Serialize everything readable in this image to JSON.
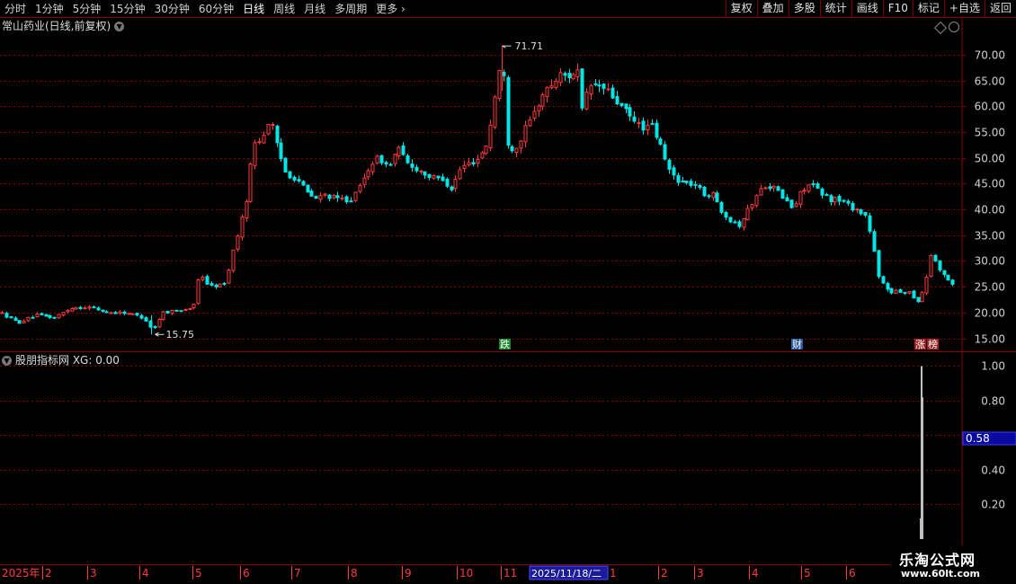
{
  "toolbar": {
    "periods": [
      {
        "label": "分时",
        "active": false
      },
      {
        "label": "1分钟",
        "active": false
      },
      {
        "label": "5分钟",
        "active": false
      },
      {
        "label": "15分钟",
        "active": false
      },
      {
        "label": "30分钟",
        "active": false
      },
      {
        "label": "60分钟",
        "active": false
      },
      {
        "label": "日线",
        "active": true
      },
      {
        "label": "周线",
        "active": false
      },
      {
        "label": "月线",
        "active": false
      },
      {
        "label": "多周期",
        "active": false
      },
      {
        "label": "更多",
        "active": false
      }
    ],
    "buttons": [
      "复权",
      "叠加",
      "多股",
      "统计",
      "画线",
      "F10",
      "标记",
      "+自选",
      "返回"
    ]
  },
  "main_panel": {
    "title": "常山药业(日线,前复权)",
    "high_label": "71.71",
    "low_label": "15.75",
    "markers": [
      {
        "text": "跌",
        "color": "#1a8a2a"
      },
      {
        "text": "财",
        "color": "#2a5aa0"
      },
      {
        "text": "涨",
        "color": "#a02020"
      },
      {
        "text": "榜",
        "color": "#a02020"
      }
    ]
  },
  "indicator_panel": {
    "title": "股朋指标网 XG: 0.00",
    "cursor_value": "0.58"
  },
  "time_axis": {
    "year_label": "2025年",
    "highlight_date": "2025/11/18/二",
    "month_labels": [
      "2",
      "3",
      "4",
      "5",
      "6",
      "7",
      "8",
      "9",
      "10",
      "11",
      "1",
      "2",
      "3",
      "4",
      "5",
      "6"
    ]
  },
  "watermark": {
    "name": "乐淘公式网",
    "url": "www.60lt.com"
  },
  "colors": {
    "up": "#ff3c3c",
    "down": "#00e6e6",
    "grid": "#8b0000",
    "axis_text": "#d0d0d0",
    "signal": "#ffffff"
  },
  "chart_data": [
    {
      "type": "candlestick",
      "title": "常山药业(日线,前复权)",
      "ylim": [
        13,
        74
      ],
      "yticks": [
        15,
        20,
        25,
        30,
        35,
        40,
        45,
        50,
        55,
        60,
        65,
        70
      ],
      "max_point": 71.71,
      "min_point": 15.75,
      "close_trace_approx": [
        [
          0,
          20
        ],
        [
          20,
          18
        ],
        [
          40,
          19.5
        ],
        [
          60,
          19
        ],
        [
          80,
          21
        ],
        [
          100,
          21
        ],
        [
          120,
          20
        ],
        [
          140,
          20
        ],
        [
          160,
          19
        ],
        [
          170,
          16.5
        ],
        [
          180,
          20
        ],
        [
          200,
          20.5
        ],
        [
          215,
          21
        ],
        [
          222,
          28
        ],
        [
          232,
          25
        ],
        [
          250,
          25.5
        ],
        [
          262,
          34
        ],
        [
          272,
          40
        ],
        [
          282,
          53
        ],
        [
          292,
          54
        ],
        [
          300,
          58
        ],
        [
          308,
          52
        ],
        [
          318,
          47
        ],
        [
          330,
          46
        ],
        [
          342,
          43
        ],
        [
          352,
          42
        ],
        [
          362,
          43
        ],
        [
          372,
          42
        ],
        [
          382,
          42
        ],
        [
          392,
          42
        ],
        [
          402,
          45
        ],
        [
          412,
          49
        ],
        [
          422,
          50
        ],
        [
          432,
          48
        ],
        [
          442,
          52
        ],
        [
          452,
          49
        ],
        [
          462,
          48
        ],
        [
          472,
          47
        ],
        [
          482,
          46
        ],
        [
          492,
          46
        ],
        [
          502,
          44
        ],
        [
          512,
          48
        ],
        [
          522,
          49
        ],
        [
          532,
          50
        ],
        [
          542,
          53
        ],
        [
          552,
          64
        ],
        [
          558,
          70
        ],
        [
          565,
          52
        ],
        [
          575,
          52
        ],
        [
          582,
          55
        ],
        [
          592,
          58
        ],
        [
          602,
          62
        ],
        [
          612,
          64
        ],
        [
          622,
          66
        ],
        [
          632,
          66
        ],
        [
          642,
          67
        ],
        [
          647,
          59
        ],
        [
          655,
          64
        ],
        [
          665,
          64
        ],
        [
          675,
          63
        ],
        [
          685,
          61
        ],
        [
          695,
          59
        ],
        [
          705,
          57
        ],
        [
          715,
          56
        ],
        [
          725,
          56
        ],
        [
          735,
          52
        ],
        [
          742,
          48
        ],
        [
          752,
          46
        ],
        [
          762,
          45
        ],
        [
          772,
          45
        ],
        [
          782,
          43
        ],
        [
          792,
          43
        ],
        [
          802,
          40
        ],
        [
          812,
          38
        ],
        [
          822,
          37
        ],
        [
          832,
          40
        ],
        [
          842,
          43
        ],
        [
          852,
          45
        ],
        [
          862,
          44
        ],
        [
          872,
          42
        ],
        [
          882,
          40
        ],
        [
          892,
          44
        ],
        [
          902,
          45
        ],
        [
          912,
          43
        ],
        [
          922,
          42
        ],
        [
          932,
          42
        ],
        [
          942,
          41
        ],
        [
          952,
          40
        ],
        [
          962,
          39
        ],
        [
          970,
          34
        ],
        [
          976,
          27
        ],
        [
          984,
          25
        ],
        [
          992,
          24
        ],
        [
          1002,
          24
        ],
        [
          1012,
          24
        ],
        [
          1020,
          22
        ],
        [
          1028,
          25
        ],
        [
          1036,
          32
        ],
        [
          1044,
          28
        ],
        [
          1052,
          27
        ],
        [
          1062,
          25
        ]
      ]
    },
    {
      "type": "line",
      "title": "股朋指标网 XG",
      "ylim": [
        0,
        1.07
      ],
      "yticks": [
        0.2,
        0.4,
        0.8,
        1.0
      ],
      "signal_value": 1.0,
      "current_value": 0.0
    }
  ]
}
